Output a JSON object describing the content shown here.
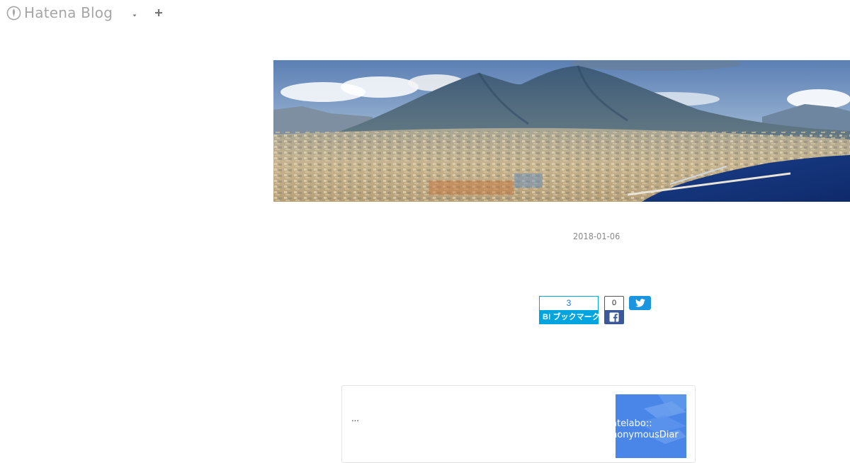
{
  "topbar": {
    "brand_name": "Hatena Blog",
    "brand_icon": "hatena-blog-logo-icon",
    "menu_icon": "caret-down-icon",
    "add_icon": "plus-icon"
  },
  "entry": {
    "date": "2018-01-06"
  },
  "share": {
    "hatena_count": "3",
    "hatena_label": "B! ブックマーク",
    "facebook_count": "0",
    "facebook_icon": "facebook-icon",
    "twitter_icon": "twitter-bird-icon"
  },
  "embed": {
    "excerpt": "...",
    "thumb_line1": "atelabo::",
    "thumb_line2": "nonymousDiar"
  },
  "colors": {
    "hatena_blue": "#00a4de",
    "facebook_blue": "#3b5998",
    "twitter_blue": "#1b95e0",
    "thumb_blue": "#4a86e8"
  }
}
